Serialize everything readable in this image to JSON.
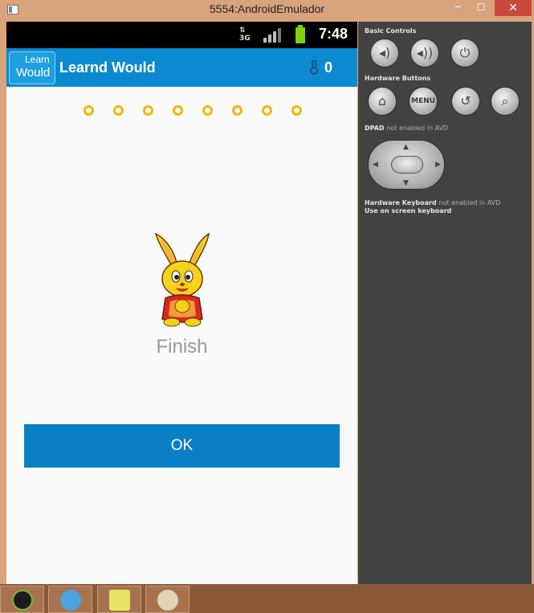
{
  "window": {
    "title": "5554:AndroidEmulador",
    "minimize_icon": "minimize-icon",
    "maximize_icon": "maximize-icon",
    "close_icon": "close-icon"
  },
  "status_bar": {
    "network": "3G",
    "time": "7:48",
    "icons": [
      "data-arrows-icon",
      "signal-icon",
      "battery-charging-icon"
    ]
  },
  "action_bar": {
    "logo_text_top": "Learn",
    "logo_text_bottom": "Would",
    "title": "Learnd Would",
    "score": "0",
    "score_icon": "medal-icon",
    "color": "#0b8ad1"
  },
  "progress": {
    "total_dots": 8,
    "color": "#f2b705"
  },
  "result": {
    "image": "rabbit-mascot",
    "label": "Finish"
  },
  "ok_button": {
    "label": "OK",
    "color": "#0b7fc6"
  },
  "emulator_controls": {
    "basic_controls_label": "Basic Controls",
    "basic_controls": [
      "volume-down-icon",
      "volume-up-icon",
      "power-icon"
    ],
    "hardware_buttons_label": "Hardware Buttons",
    "hardware_buttons": [
      "home-icon",
      "MENU",
      "back-icon",
      "search-icon"
    ],
    "dpad_label": "DPAD",
    "dpad_note": "not enabled in AVD",
    "keyboard_label": "Hardware Keyboard",
    "keyboard_note": "not enabled in AVD",
    "keyboard_line2": "Use on screen keyboard"
  },
  "taskbar": {
    "items": [
      "android-terminal-icon",
      "cat-app-icon",
      "sticky-notes-icon",
      "paint-icon"
    ]
  }
}
